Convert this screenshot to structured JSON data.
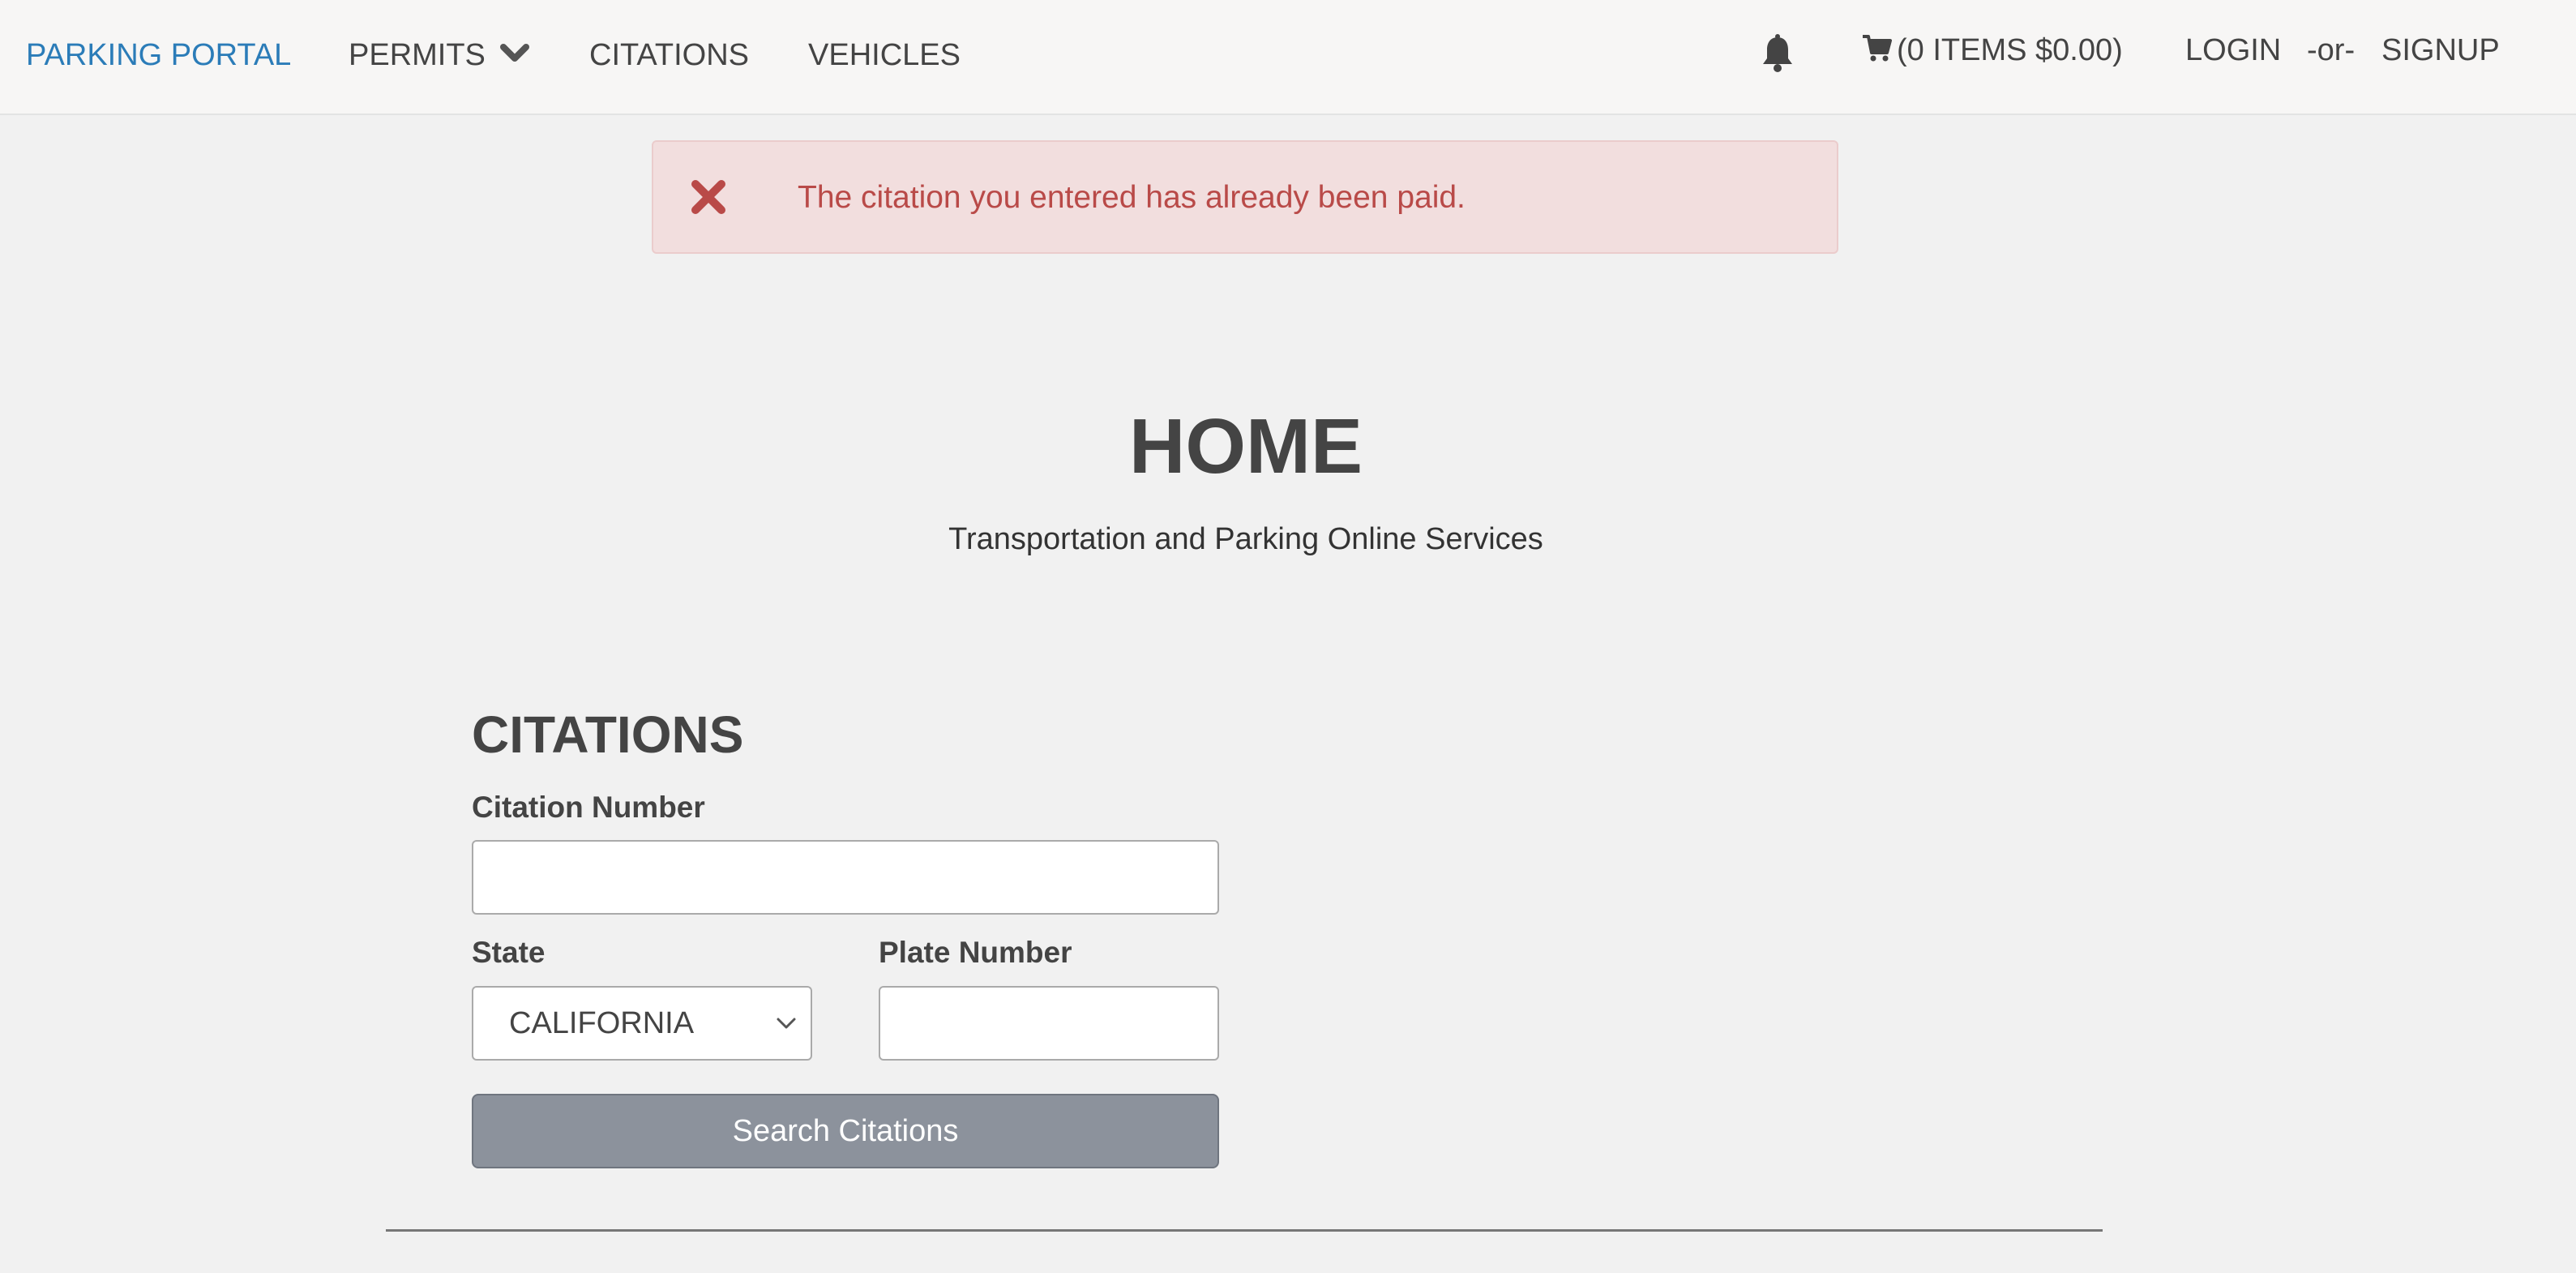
{
  "nav": {
    "brand": "PARKING PORTAL",
    "permits": "PERMITS",
    "citations": "CITATIONS",
    "vehicles": "VEHICLES",
    "cart": "(0 ITEMS $0.00)",
    "login": "LOGIN",
    "or": "-or-",
    "signup": "SIGNUP",
    "icons": {
      "permits_dropdown": "chevron-down-icon",
      "notifications": "bell-icon",
      "cart": "cart-icon"
    }
  },
  "alert": {
    "message": "The citation you entered has already been paid.",
    "icon": "close-x-icon",
    "text_color": "#b94a48",
    "background_color": "#f2dede"
  },
  "home": {
    "title": "HOME",
    "subtitle": "Transportation and Parking Online Services"
  },
  "citations_form": {
    "title": "CITATIONS",
    "citation_number_label": "Citation Number",
    "citation_number_value": "",
    "state_label": "State",
    "state_value": "CALIFORNIA",
    "plate_number_label": "Plate Number",
    "plate_number_value": "",
    "search_button": "Search Citations",
    "button_color": "#8c929c"
  },
  "colors": {
    "brand": "#2b7cb8",
    "page_background": "#f1f1f1",
    "navbar_background": "#f7f6f5"
  }
}
